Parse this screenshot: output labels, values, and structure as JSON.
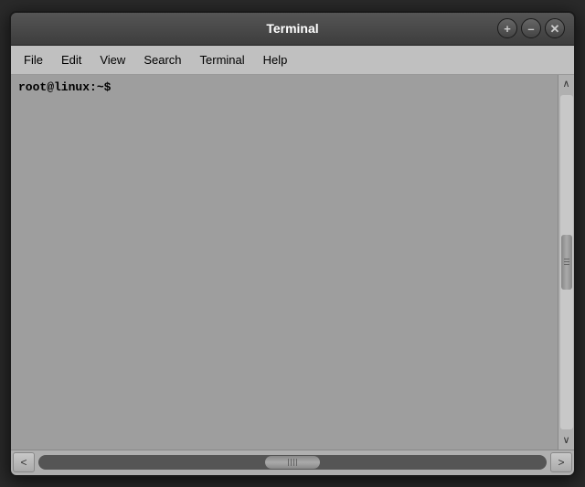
{
  "titlebar": {
    "title": "Terminal",
    "buttons": {
      "add": "+",
      "minimize": "–",
      "close": "✕"
    }
  },
  "menubar": {
    "items": [
      "File",
      "Edit",
      "View",
      "Search",
      "Terminal",
      "Help"
    ]
  },
  "terminal": {
    "prompt": "root@linux:~$"
  },
  "scrollbar": {
    "up_arrow": "∧",
    "down_arrow": "∨",
    "left_arrow": "<",
    "right_arrow": ">"
  }
}
